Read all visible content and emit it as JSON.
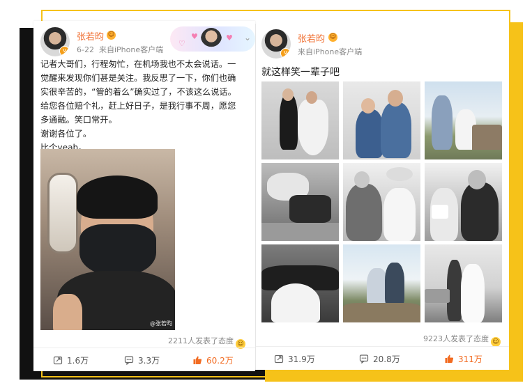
{
  "left_post": {
    "author": "张若昀",
    "date": "6-22",
    "source": "来自iPhone客户端",
    "text_lines": [
      "记者大哥们，行程匆忙，在机场我也不太会说话。一",
      "觉醒来发现你们甚是关注。我反思了一下，你们也确",
      "实很辛苦的，“管的着么”确实过了，不该这么说话。",
      "给您各位赔个礼，赶上好日子，是我行事不周，愿您",
      "多通融。笑口常开。",
      "谢谢各位了。",
      "比个yeah。"
    ],
    "photo_watermark": "@张若昀",
    "reaction_summary": "2211人发表了态度",
    "actions": {
      "repost": "1.6万",
      "comment": "3.3万",
      "like": "60.2万"
    }
  },
  "right_post": {
    "author": "张若昀",
    "source": "来自iPhone客户端",
    "text": "就这样笑一辈子吧",
    "reaction_summary": "9223人发表了态度",
    "actions": {
      "repost": "31.9万",
      "comment": "20.8万",
      "like": "311万"
    }
  },
  "colors": {
    "accent_yellow": "#f6c219",
    "username_orange": "#f06b2b",
    "like_orange": "#f26b21",
    "meta_gray": "#8a8a8a"
  },
  "icons": [
    "verified-badge-icon",
    "vip-emoji-icon",
    "chevron-down-icon",
    "repost-icon",
    "comment-icon",
    "like-icon",
    "laugh-emoji-icon"
  ]
}
